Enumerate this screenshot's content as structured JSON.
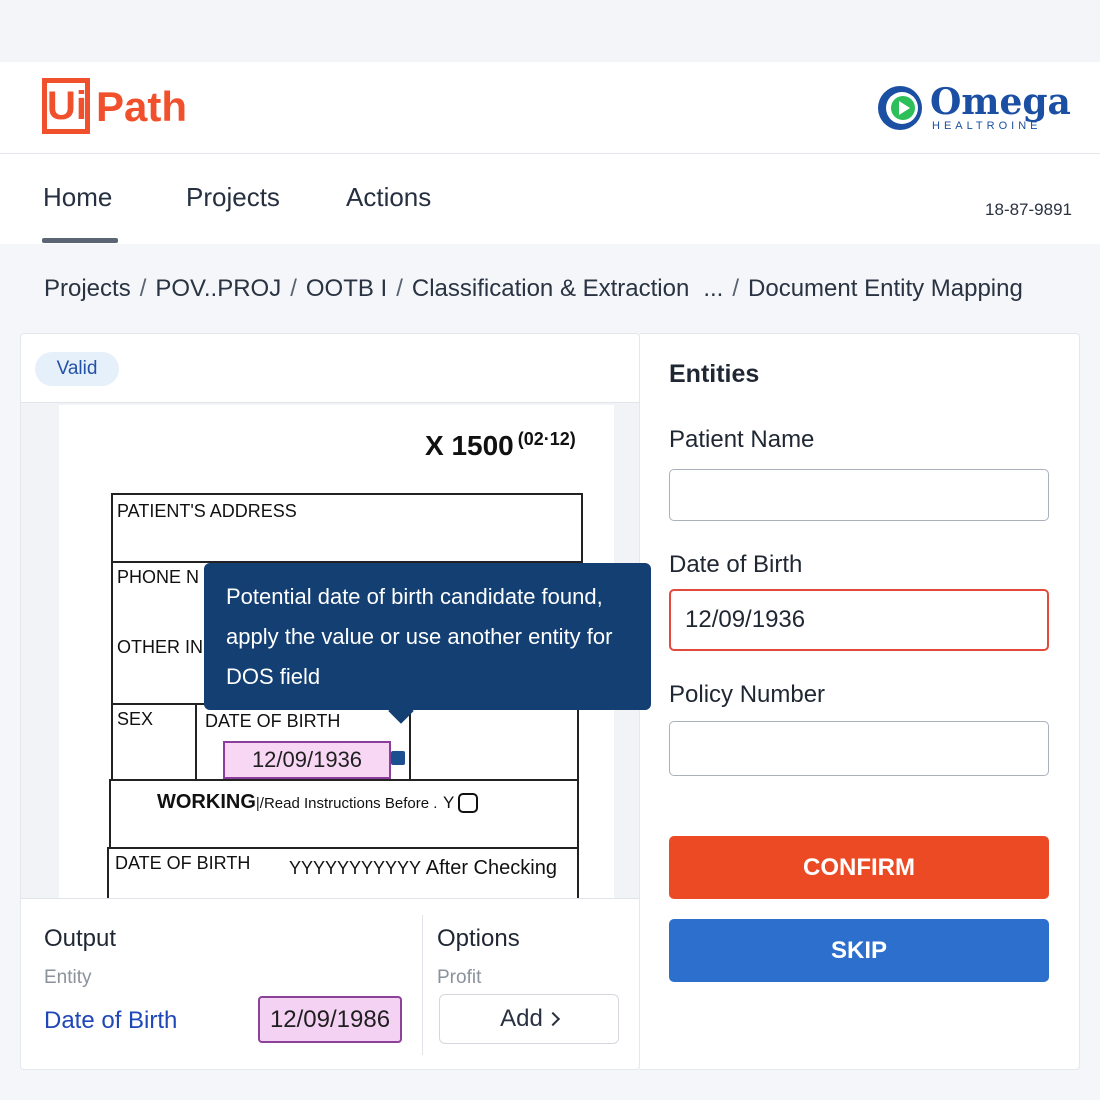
{
  "header": {
    "logo_ui": "Ui",
    "logo_path": "Path",
    "partner_name": "Omega",
    "partner_sub": "HEALTROINE"
  },
  "nav": {
    "tabs": [
      {
        "label": "Home",
        "active": true
      },
      {
        "label": "Projects",
        "active": false
      },
      {
        "label": "Actions",
        "active": false
      }
    ],
    "phone": "18-87-9891"
  },
  "breadcrumb": [
    "Projects",
    "POV..PROJ",
    "OOTB I",
    "Classification & Extraction",
    "...",
    "Document Entity Mapping"
  ],
  "document": {
    "status_badge": "Valid",
    "form_title": "X 1500",
    "form_version": "(02·12)",
    "labels": {
      "address": "PATIENT'S ADDRESS",
      "phone": "PHONE N",
      "other": "OTHER IN",
      "sex": "SEX",
      "dob": "DATE OF BIRTH",
      "working": "WORKING",
      "working_note": "|/Read Instructions Before .",
      "working_y": "Y",
      "dob2": "DATE OF BIRTH",
      "dob2_format": "YYYYYYYYYYY",
      "dob2_after": "After  Checking"
    },
    "highlighted_value": "12/09/1936",
    "tooltip": "Potential date of birth candidate found, apply the value or use another entity for DOS field"
  },
  "output": {
    "title": "Output",
    "entity_label": "Entity",
    "entity_name": "Date of Birth",
    "entity_value": "12/09/1986"
  },
  "options": {
    "title": "Options",
    "label": "Profit",
    "add_button": "Add"
  },
  "entities": {
    "title": "Entities",
    "fields": [
      {
        "label": "Patient Name",
        "value": "",
        "error": false
      },
      {
        "label": "Date of Birth",
        "value": "12/09/1936",
        "error": true
      },
      {
        "label": "Policy Number",
        "value": "",
        "error": false
      }
    ],
    "confirm_button": "CONFIRM",
    "skip_button": "SKIP"
  },
  "colors": {
    "brand_orange": "#f0512c",
    "confirm": "#ec4a24",
    "skip": "#2d6fcc",
    "tooltip": "#133f73",
    "highlight": "#f8d7f5",
    "error_border": "#e24b3b"
  }
}
